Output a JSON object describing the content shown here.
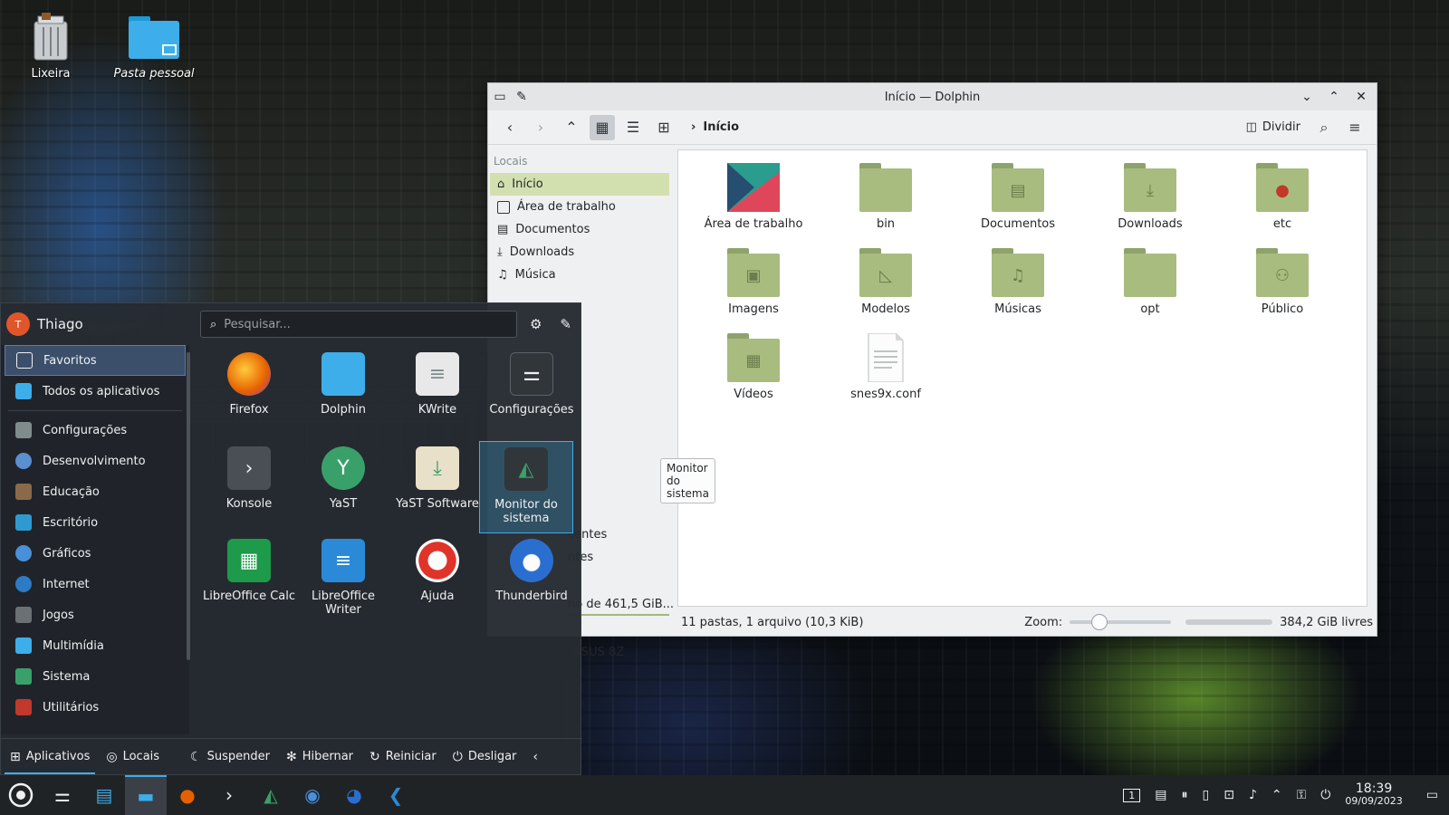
{
  "desktop": {
    "icons": [
      {
        "label": "Lixeira",
        "icon": "trash-icon"
      },
      {
        "label": "Pasta pessoal",
        "icon": "home-folder-icon"
      }
    ]
  },
  "dolphin": {
    "title": "Início — Dolphin",
    "breadcrumb": "Início",
    "split_label": "Dividir",
    "places_header": "Locais",
    "places": [
      {
        "label": "Início",
        "selected": true
      },
      {
        "label": "Área de trabalho"
      },
      {
        "label": "Documentos"
      },
      {
        "label": "Downloads"
      },
      {
        "label": "Música"
      }
    ],
    "places_partial": [
      {
        "label": "centes"
      },
      {
        "label": "ntes"
      },
      {
        "label": "no de 461,5 GiB..."
      },
      {
        "label": "ASUS 8Z"
      }
    ],
    "files": [
      {
        "name": "Área de trabalho",
        "type": "desktop"
      },
      {
        "name": "bin",
        "type": "folder"
      },
      {
        "name": "Documentos",
        "type": "folder"
      },
      {
        "name": "Downloads",
        "type": "folder"
      },
      {
        "name": "etc",
        "type": "folder"
      },
      {
        "name": "Imagens",
        "type": "folder"
      },
      {
        "name": "Modelos",
        "type": "folder"
      },
      {
        "name": "Músicas",
        "type": "folder"
      },
      {
        "name": "opt",
        "type": "folder"
      },
      {
        "name": "Público",
        "type": "folder"
      },
      {
        "name": "Vídeos",
        "type": "folder"
      },
      {
        "name": "snes9x.conf",
        "type": "file"
      }
    ],
    "status": "11 pastas, 1 arquivo (10,3 KiB)",
    "zoom_label": "Zoom:",
    "free_space": "384,2 GiB livres"
  },
  "kickoff": {
    "user": "Thiago",
    "avatar_initial": "T",
    "search_placeholder": "Pesquisar...",
    "categories": [
      {
        "label": "Favoritos",
        "selected": true,
        "color": "#3b4f6b"
      },
      {
        "label": "Todos os aplicativos",
        "color": "#3daee9"
      },
      {
        "label": "Configurações",
        "color": "#7f8c8d"
      },
      {
        "label": "Desenvolvimento",
        "color": "#5a8fd0"
      },
      {
        "label": "Educação",
        "color": "#8b6a4a"
      },
      {
        "label": "Escritório",
        "color": "#2e9ad0"
      },
      {
        "label": "Gráficos",
        "color": "#4a90d9"
      },
      {
        "label": "Internet",
        "color": "#2c7bc4"
      },
      {
        "label": "Jogos",
        "color": "#6b7075"
      },
      {
        "label": "Multimídia",
        "color": "#3daee9"
      },
      {
        "label": "Sistema",
        "color": "#3aa06a"
      },
      {
        "label": "Utilitários",
        "color": "#c0392b"
      }
    ],
    "apps": [
      {
        "label": "Firefox",
        "bg": "#e66000"
      },
      {
        "label": "Dolphin",
        "bg": "#3daee9"
      },
      {
        "label": "KWrite",
        "bg": "#e8e8e8"
      },
      {
        "label": "Configurações",
        "bg": "#31363b"
      },
      {
        "label": "Konsole",
        "bg": "#4a4f55"
      },
      {
        "label": "YaST",
        "bg": "#3aa06a"
      },
      {
        "label": "YaST Software",
        "bg": "#e8e0c8"
      },
      {
        "label": "Monitor do sistema",
        "bg": "#31363b"
      },
      {
        "label": "LibreOffice Calc",
        "bg": "#1d9a4a"
      },
      {
        "label": "LibreOffice Writer",
        "bg": "#2a8ad8"
      },
      {
        "label": "Ajuda",
        "bg": "#fcfcfc"
      },
      {
        "label": "Thunderbird",
        "bg": "#2a6fd0"
      }
    ],
    "tooltip": "Monitor do sistema",
    "footer": {
      "apps": "Aplicativos",
      "places": "Locais",
      "suspend": "Suspender",
      "hibernate": "Hibernar",
      "restart": "Reiniciar",
      "shutdown": "Desligar"
    }
  },
  "taskbar": {
    "pager": "1",
    "time": "18:39",
    "date": "09/09/2023"
  }
}
